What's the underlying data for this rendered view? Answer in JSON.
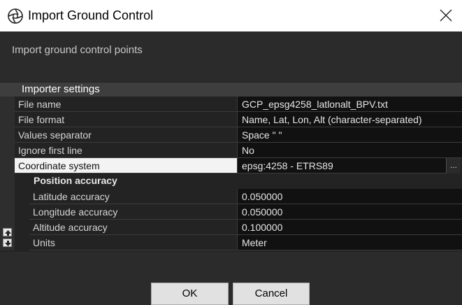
{
  "window": {
    "title": "Import Ground Control",
    "subtitle": "Import ground control points"
  },
  "importer": {
    "header": "Importer settings",
    "rows": [
      {
        "label": "File name",
        "value": "GCP_epsg4258_latlonalt_BPV.txt"
      },
      {
        "label": "File format",
        "value": "Name, Lat, Lon, Alt (character-separated)"
      },
      {
        "label": "Values separator",
        "value": "Space \" \""
      },
      {
        "label": "Ignore first line",
        "value": "No"
      },
      {
        "label": "Coordinate system",
        "value": "epsg:4258 - ETRS89",
        "browse_label": "..."
      }
    ],
    "position_accuracy": {
      "header": "Position accuracy",
      "rows": [
        {
          "label": "Latitude accuracy",
          "value": "0.050000"
        },
        {
          "label": "Longitude accuracy",
          "value": "0.050000"
        },
        {
          "label": "Altitude accuracy",
          "value": "0.100000"
        },
        {
          "label": "Units",
          "value": "Meter"
        }
      ]
    }
  },
  "buttons": {
    "ok": "OK",
    "cancel": "Cancel"
  },
  "icons": {
    "app": "aperture-icon",
    "close": "close-icon",
    "sort_up": "sort-ascending-icon",
    "sort_down": "sort-descending-icon"
  }
}
